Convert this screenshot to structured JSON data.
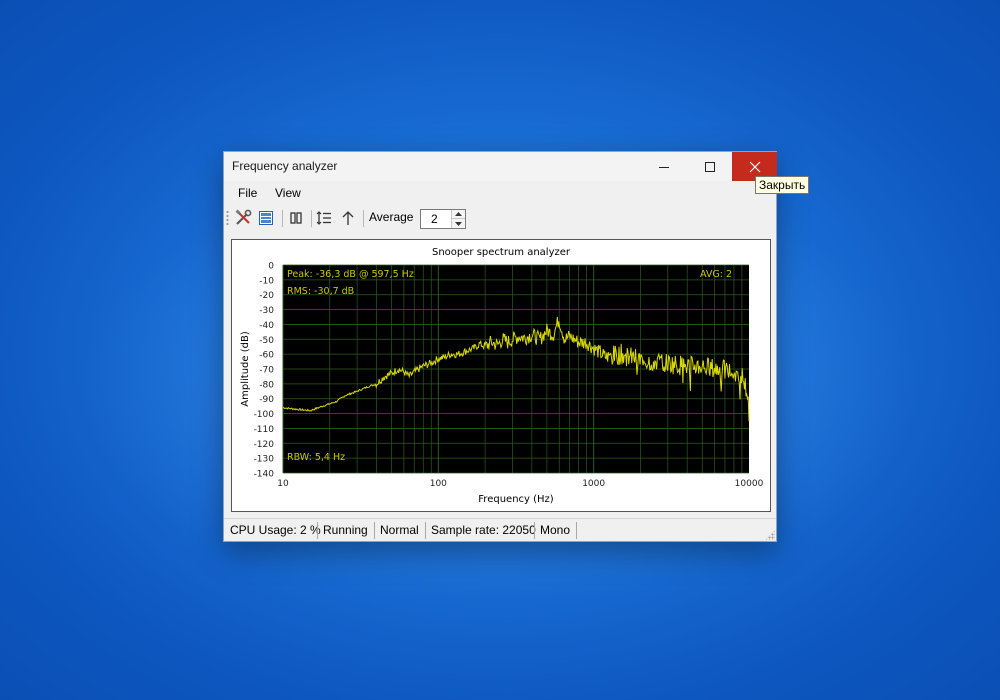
{
  "window": {
    "title": "Frequency analyzer",
    "controls": {
      "minimize_icon": "minimize-icon",
      "maximize_icon": "maximize-icon",
      "close_icon": "close-icon"
    },
    "close_tooltip": "Закрыть"
  },
  "menu": [
    {
      "label": "File"
    },
    {
      "label": "View"
    }
  ],
  "toolbar": {
    "buttons": [
      {
        "icon": "tools-icon"
      },
      {
        "icon": "panels-icon"
      },
      {
        "icon": "pause-icon"
      },
      {
        "icon": "line-spacing-icon"
      },
      {
        "icon": "arrow-up-icon"
      }
    ],
    "average_label": "Average",
    "average_value": "2"
  },
  "chart_data": {
    "type": "line",
    "title": "Snooper spectrum analyzer",
    "xlabel": "Frequency (Hz)",
    "ylabel": "Amplitude (dB)",
    "x_scale": "log",
    "xlim": [
      10,
      10000
    ],
    "ylim": [
      -140,
      0
    ],
    "x_ticks": [
      "10",
      "100",
      "1000",
      "10000"
    ],
    "y_ticks": [
      "0",
      "-10",
      "-20",
      "-30",
      "-40",
      "-50",
      "-60",
      "-70",
      "-80",
      "-90",
      "-100",
      "-110",
      "-120",
      "-130",
      "-140"
    ],
    "grid": true,
    "background": "#000000",
    "grid_color": "#2e5a22",
    "line_color": "#d8d800",
    "annotations": {
      "peak": "Peak: -36,3 dB @ 597,5 Hz",
      "rms": "RMS: -30,7 dB",
      "avg": "AVG: 2",
      "rbw": "RBW: 5,4 Hz"
    },
    "series": [
      {
        "x": [
          10,
          12,
          15,
          18,
          22,
          25,
          30,
          35,
          40,
          45,
          50,
          55,
          60,
          65,
          70,
          80,
          90,
          100,
          110,
          120,
          135,
          150,
          170,
          185,
          200,
          220,
          240,
          260,
          280,
          300,
          330,
          360,
          400,
          450,
          500,
          550,
          597.5,
          650,
          700,
          800,
          900,
          1000,
          1200,
          1500,
          2000,
          2500,
          3000,
          4000,
          5000,
          6000,
          7000,
          8000,
          9000,
          10000
        ],
        "y": [
          -96,
          -97,
          -98,
          -95,
          -92,
          -88,
          -85,
          -82,
          -80,
          -75,
          -73,
          -70,
          -72,
          -75,
          -72,
          -68,
          -66,
          -63,
          -62,
          -60,
          -60,
          -58,
          -56,
          -53,
          -55,
          -52,
          -54,
          -50,
          -52,
          -50,
          -48,
          -49,
          -47,
          -50,
          -44,
          -47,
          -36.3,
          -50,
          -48,
          -52,
          -52,
          -56,
          -62,
          -60,
          -64,
          -65,
          -66,
          -68,
          -68,
          -70,
          -71,
          -73,
          -74,
          -90
        ]
      }
    ]
  },
  "status": {
    "cpu": "CPU Usage: 2 %",
    "state": "Running",
    "mode": "Normal",
    "sample_rate": "Sample rate: 22050",
    "channels": "Mono"
  }
}
